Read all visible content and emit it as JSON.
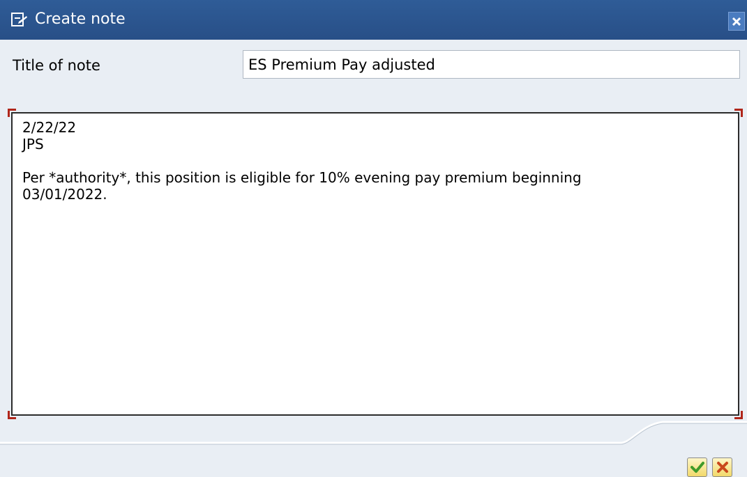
{
  "window": {
    "title": "Create note",
    "close_icon": "close-icon",
    "title_icon": "note-edit-icon",
    "title_bar_color": "#2c5690"
  },
  "form": {
    "title_label": "Title of note",
    "title_value": "ES Premium Pay adjusted"
  },
  "editor": {
    "text": "2/22/22\nJPS\n\nPer *authority*, this position is eligible for 10% evening pay premium beginning\n03/01/2022."
  },
  "footer": {
    "ok_icon": "checkmark-icon",
    "cancel_icon": "cancel-x-icon",
    "ok_color": "#3f9b2a",
    "cancel_color": "#c9481c"
  }
}
